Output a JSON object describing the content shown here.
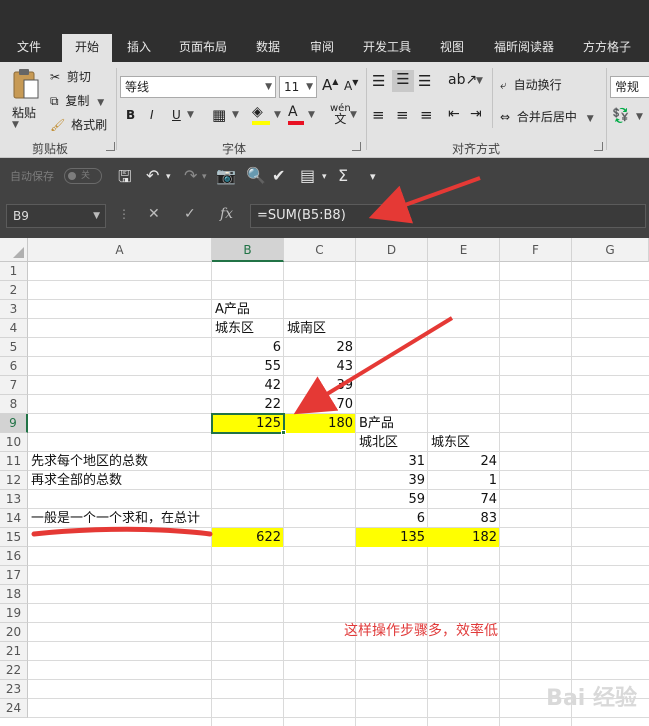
{
  "tabs": [
    "文件",
    "开始",
    "插入",
    "页面布局",
    "数据",
    "审阅",
    "开发工具",
    "视图",
    "福昕阅读器",
    "方方格子"
  ],
  "ribbon": {
    "clipboard": {
      "paste": "粘贴",
      "cut": "剪切",
      "copy": "复制",
      "format_painter": "格式刷",
      "group": "剪贴板"
    },
    "font": {
      "name": "等线",
      "size": "11",
      "bold": "B",
      "italic": "I",
      "underline": "U",
      "phonetic": "wén",
      "phonetic_char": "文",
      "group": "字体"
    },
    "alignment": {
      "wrap": "自动换行",
      "merge": "合并后居中",
      "group": "对齐方式"
    },
    "number": {
      "format": "常规"
    },
    "accent_fill": "#ffff00",
    "accent_font": "#e81123"
  },
  "qat": {
    "autosave_label": "自动保存",
    "autosave_state": "关"
  },
  "formula_bar": {
    "name_box": "B9",
    "fx": "fx",
    "formula": "=SUM(B5:B8)"
  },
  "sheet": {
    "columns": [
      "A",
      "B",
      "C",
      "D",
      "E",
      "F",
      "G"
    ],
    "selected_column": "B",
    "selected_row": "9",
    "rows": [
      "1",
      "2",
      "3",
      "4",
      "5",
      "6",
      "7",
      "8",
      "9",
      "10",
      "11",
      "12",
      "13",
      "14",
      "15",
      "16",
      "17",
      "18",
      "19",
      "20",
      "21",
      "22",
      "23",
      "24"
    ],
    "cells": {
      "B3": "A产品",
      "B4": "城东区",
      "C4": "城南区",
      "B5": "6",
      "C5": "28",
      "B6": "55",
      "C6": "43",
      "B7": "42",
      "C7": "39",
      "B8": "22",
      "C8": "70",
      "B9": "125",
      "C9": "180",
      "D9": "B产品",
      "D10": "城北区",
      "E10": "城东区",
      "A11": "先求每个地区的总数",
      "D11": "31",
      "E11": "24",
      "A12": "再求全部的总数",
      "D12": "39",
      "E12": "1",
      "D13": "59",
      "E13": "74",
      "A14": "一般是一个一个求和，在总计",
      "D14": "6",
      "E14": "83",
      "B15": "622",
      "D15": "135",
      "E15": "182"
    },
    "highlight_color": "#ffff00"
  },
  "annotations": {
    "note": "这样操作步骤多，效率低",
    "color": "#e03a3a"
  },
  "watermark": "Bai 经验"
}
